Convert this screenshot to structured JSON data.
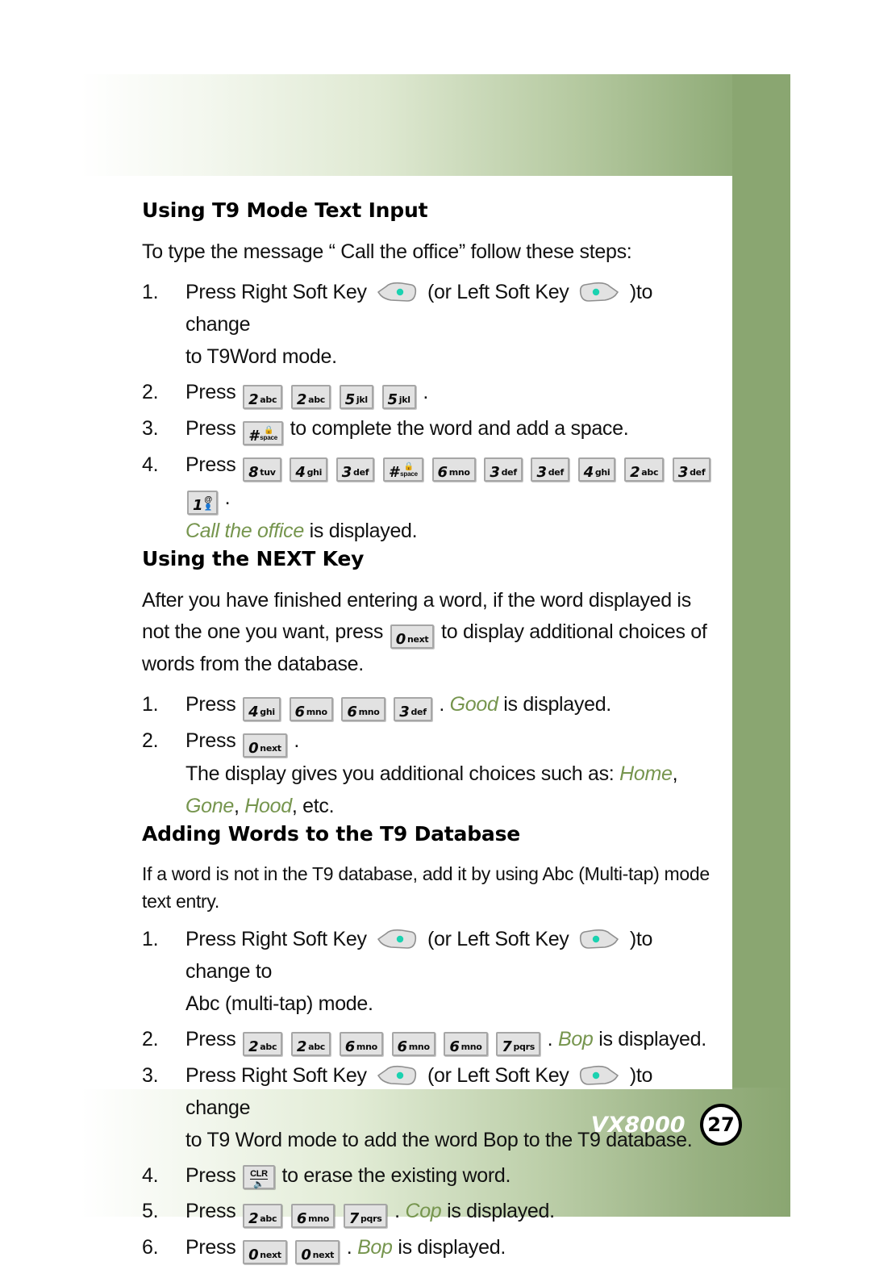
{
  "colors": {
    "accent_green": "#8aa671",
    "display_word_green": "#76954e",
    "softkey_dot_teal": "#1bd2b0",
    "key_face": "#e2e2e2",
    "key_border": "#a6a6a6"
  },
  "sections": {
    "t9_mode": {
      "title": "Using T9 Mode Text Input",
      "intro": "To type the message “ Call the office”  follow these steps:",
      "steps": {
        "s1": {
          "num": "1.",
          "a": "Press Right Soft Key",
          "b": "(or Left Soft Key",
          "c": ")to change",
          "d": "to T9Word mode."
        },
        "s2": {
          "num": "2.",
          "a": "Press",
          "end": "."
        },
        "s3": {
          "num": "3.",
          "a": "Press",
          "b": "to complete the word and add a space."
        },
        "s4": {
          "num": "4.",
          "a": "Press",
          "end": ".",
          "result_word": "Call the office",
          "result_tail": "is displayed."
        }
      }
    },
    "next_key": {
      "title": "Using the NEXT Key",
      "intro_a": "After you have finished entering a word, if the word displayed is not the one you want, press",
      "intro_b": "to display additional choices of words from the database.",
      "steps": {
        "s1": {
          "num": "1.",
          "a": "Press",
          "sep": ".",
          "result_word": "Good",
          "result_tail": "is displayed."
        },
        "s2": {
          "num": "2.",
          "a": "Press",
          "end": ".",
          "line2_a": "The display gives you additional choices such as:",
          "line2_w1": "Home",
          "line2_c1": ",",
          "line3_w1": "Gone",
          "line3_c1": ",",
          "line3_w2": "Hood",
          "line3_tail": ", etc."
        }
      }
    },
    "adding_words": {
      "title": "Adding Words to the T9 Database",
      "intro": "If a word is not in the T9 database, add it by using Abc (Multi-tap) mode text entry.",
      "steps": {
        "s1": {
          "num": "1.",
          "a": "Press Right Soft Key",
          "b": "(or Left Soft Key",
          "c": ")to change to",
          "d": "Abc (multi-tap) mode."
        },
        "s2": {
          "num": "2.",
          "a": "Press",
          "sep": ".",
          "result_word": "Bop",
          "result_tail": "is displayed."
        },
        "s3": {
          "num": "3.",
          "a": "Press Right Soft Key",
          "b": "(or Left Soft Key",
          "c": ")to change",
          "d": "to T9 Word mode to add the word Bop to the T9 database."
        },
        "s4": {
          "num": "4.",
          "a": "Press",
          "b": "to erase the existing word."
        },
        "s5": {
          "num": "5.",
          "a": "Press",
          "sep": ".",
          "result_word": "Cop",
          "result_tail": "is displayed."
        },
        "s6": {
          "num": "6.",
          "a": "Press",
          "sep": ".",
          "result_word": "Bop",
          "result_tail": "is displayed."
        }
      }
    }
  },
  "keys": {
    "k2": {
      "digit": "2",
      "label": "abc"
    },
    "k3": {
      "digit": "3",
      "label": "def"
    },
    "k4": {
      "digit": "4",
      "label": "ghi"
    },
    "k5": {
      "digit": "5",
      "label": "jkl"
    },
    "k6": {
      "digit": "6",
      "label": "mno"
    },
    "k7": {
      "digit": "7",
      "label": "pqrs"
    },
    "k8": {
      "digit": "8",
      "label": "tuv"
    },
    "k0": {
      "digit": "0",
      "label": "next"
    },
    "k1": {
      "digit": "1",
      "label": ""
    },
    "khash": {
      "digit": "#",
      "label_top": "â",
      "label_bottom": "space"
    },
    "kclr": {
      "top": "CLR",
      "bottom": "◂)"
    }
  },
  "footer": {
    "model": "VX8000",
    "page": "27"
  }
}
